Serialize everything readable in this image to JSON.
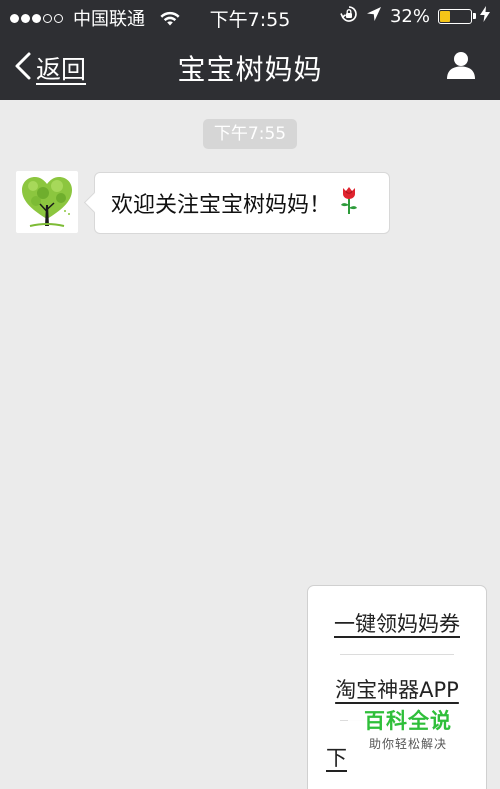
{
  "status_bar": {
    "carrier": "中国联通",
    "time": "下午7:55",
    "battery_percent": "32%",
    "battery_level": 0.32,
    "signal_strength": 3,
    "signal_max": 5,
    "icons": [
      "wifi-icon",
      "orientation-lock-icon",
      "location-arrow-icon",
      "battery-icon",
      "charging-bolt-icon"
    ]
  },
  "nav": {
    "back_label": "返回",
    "title": "宝宝树妈妈",
    "icons": [
      "chevron-left-icon",
      "profile-icon"
    ]
  },
  "chat": {
    "timestamp": "下午7:55",
    "messages": [
      {
        "sender": "宝宝树妈妈",
        "avatar_icon": "heart-tree-icon",
        "text": "欢迎关注宝宝树妈妈！",
        "emoji_icon": "rose-icon"
      }
    ]
  },
  "menu": {
    "items": [
      {
        "label": "一键领妈妈券"
      },
      {
        "label": "淘宝神器APP"
      },
      {
        "label": "下"
      }
    ]
  },
  "watermark": {
    "title": "百科全说",
    "subtitle": "助你轻松解决"
  },
  "colors": {
    "bar_background": "#2e2f33",
    "chat_background": "#ebebeb",
    "battery_fill": "#f5c518",
    "watermark_green": "#2fbf3a"
  }
}
